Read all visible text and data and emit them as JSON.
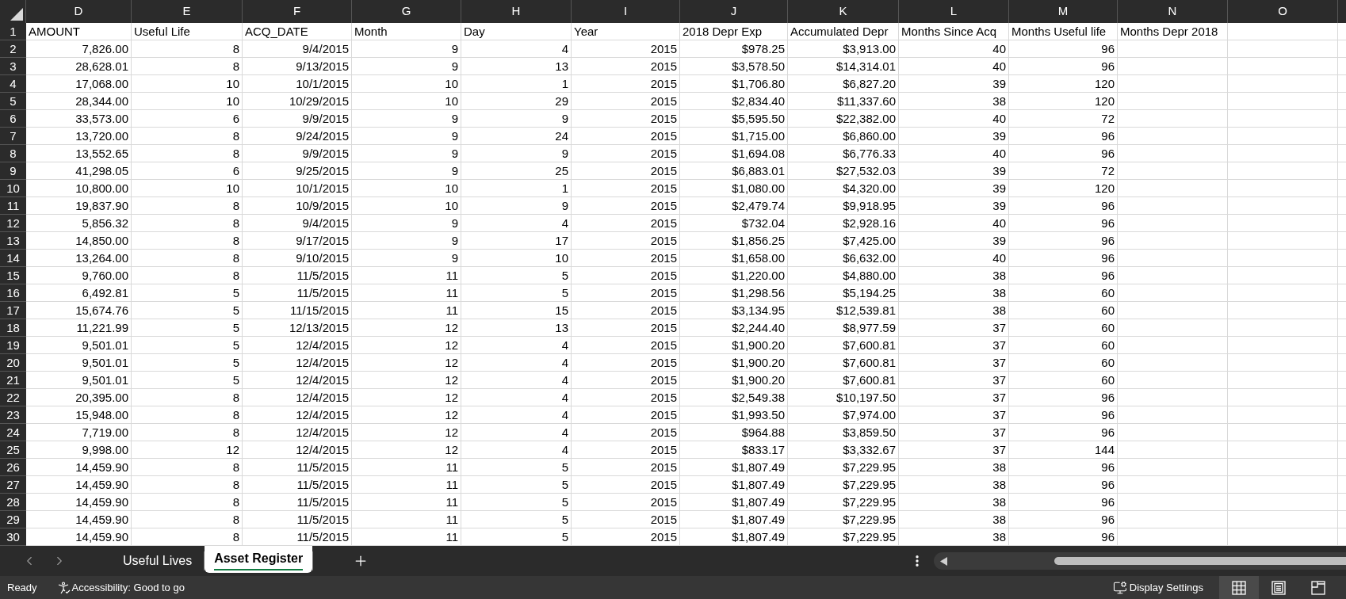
{
  "columns": [
    "D",
    "E",
    "F",
    "G",
    "H",
    "I",
    "J",
    "K",
    "L",
    "M",
    "N",
    "O"
  ],
  "rows": [
    {
      "number": "1",
      "kind": "text",
      "cells": [
        "AMOUNT",
        "Useful Life",
        "ACQ_DATE",
        "Month",
        "Day",
        "Year",
        "2018 Depr Exp",
        "Accumulated Depr",
        "Months Since Acq",
        "Months Useful life",
        "Months Depr 2018"
      ]
    },
    {
      "number": "2",
      "kind": "number",
      "cells": [
        "7,826.00",
        "8",
        "9/4/2015",
        "9",
        "4",
        "2015",
        "$978.25",
        "$3,913.00",
        "40",
        "96"
      ]
    },
    {
      "number": "3",
      "kind": "number",
      "cells": [
        "28,628.01",
        "8",
        "9/13/2015",
        "9",
        "13",
        "2015",
        "$3,578.50",
        "$14,314.01",
        "40",
        "96"
      ]
    },
    {
      "number": "4",
      "kind": "number",
      "cells": [
        "17,068.00",
        "10",
        "10/1/2015",
        "10",
        "1",
        "2015",
        "$1,706.80",
        "$6,827.20",
        "39",
        "120"
      ]
    },
    {
      "number": "5",
      "kind": "number",
      "cells": [
        "28,344.00",
        "10",
        "10/29/2015",
        "10",
        "29",
        "2015",
        "$2,834.40",
        "$11,337.60",
        "38",
        "120"
      ]
    },
    {
      "number": "6",
      "kind": "number",
      "cells": [
        "33,573.00",
        "6",
        "9/9/2015",
        "9",
        "9",
        "2015",
        "$5,595.50",
        "$22,382.00",
        "40",
        "72"
      ]
    },
    {
      "number": "7",
      "kind": "number",
      "cells": [
        "13,720.00",
        "8",
        "9/24/2015",
        "9",
        "24",
        "2015",
        "$1,715.00",
        "$6,860.00",
        "39",
        "96"
      ]
    },
    {
      "number": "8",
      "kind": "number",
      "cells": [
        "13,552.65",
        "8",
        "9/9/2015",
        "9",
        "9",
        "2015",
        "$1,694.08",
        "$6,776.33",
        "40",
        "96"
      ]
    },
    {
      "number": "9",
      "kind": "number",
      "cells": [
        "41,298.05",
        "6",
        "9/25/2015",
        "9",
        "25",
        "2015",
        "$6,883.01",
        "$27,532.03",
        "39",
        "72"
      ]
    },
    {
      "number": "10",
      "kind": "number",
      "cells": [
        "10,800.00",
        "10",
        "10/1/2015",
        "10",
        "1",
        "2015",
        "$1,080.00",
        "$4,320.00",
        "39",
        "120"
      ]
    },
    {
      "number": "11",
      "kind": "number",
      "cells": [
        "19,837.90",
        "8",
        "10/9/2015",
        "10",
        "9",
        "2015",
        "$2,479.74",
        "$9,918.95",
        "39",
        "96"
      ]
    },
    {
      "number": "12",
      "kind": "number",
      "cells": [
        "5,856.32",
        "8",
        "9/4/2015",
        "9",
        "4",
        "2015",
        "$732.04",
        "$2,928.16",
        "40",
        "96"
      ]
    },
    {
      "number": "13",
      "kind": "number",
      "cells": [
        "14,850.00",
        "8",
        "9/17/2015",
        "9",
        "17",
        "2015",
        "$1,856.25",
        "$7,425.00",
        "39",
        "96"
      ]
    },
    {
      "number": "14",
      "kind": "number",
      "cells": [
        "13,264.00",
        "8",
        "9/10/2015",
        "9",
        "10",
        "2015",
        "$1,658.00",
        "$6,632.00",
        "40",
        "96"
      ]
    },
    {
      "number": "15",
      "kind": "number",
      "cells": [
        "9,760.00",
        "8",
        "11/5/2015",
        "11",
        "5",
        "2015",
        "$1,220.00",
        "$4,880.00",
        "38",
        "96"
      ]
    },
    {
      "number": "16",
      "kind": "number",
      "cells": [
        "6,492.81",
        "5",
        "11/5/2015",
        "11",
        "5",
        "2015",
        "$1,298.56",
        "$5,194.25",
        "38",
        "60"
      ]
    },
    {
      "number": "17",
      "kind": "number",
      "cells": [
        "15,674.76",
        "5",
        "11/15/2015",
        "11",
        "15",
        "2015",
        "$3,134.95",
        "$12,539.81",
        "38",
        "60"
      ]
    },
    {
      "number": "18",
      "kind": "number",
      "cells": [
        "11,221.99",
        "5",
        "12/13/2015",
        "12",
        "13",
        "2015",
        "$2,244.40",
        "$8,977.59",
        "37",
        "60"
      ]
    },
    {
      "number": "19",
      "kind": "number",
      "cells": [
        "9,501.01",
        "5",
        "12/4/2015",
        "12",
        "4",
        "2015",
        "$1,900.20",
        "$7,600.81",
        "37",
        "60"
      ]
    },
    {
      "number": "20",
      "kind": "number",
      "cells": [
        "9,501.01",
        "5",
        "12/4/2015",
        "12",
        "4",
        "2015",
        "$1,900.20",
        "$7,600.81",
        "37",
        "60"
      ]
    },
    {
      "number": "21",
      "kind": "number",
      "cells": [
        "9,501.01",
        "5",
        "12/4/2015",
        "12",
        "4",
        "2015",
        "$1,900.20",
        "$7,600.81",
        "37",
        "60"
      ]
    },
    {
      "number": "22",
      "kind": "number",
      "cells": [
        "20,395.00",
        "8",
        "12/4/2015",
        "12",
        "4",
        "2015",
        "$2,549.38",
        "$10,197.50",
        "37",
        "96"
      ]
    },
    {
      "number": "23",
      "kind": "number",
      "cells": [
        "15,948.00",
        "8",
        "12/4/2015",
        "12",
        "4",
        "2015",
        "$1,993.50",
        "$7,974.00",
        "37",
        "96"
      ]
    },
    {
      "number": "24",
      "kind": "number",
      "cells": [
        "7,719.00",
        "8",
        "12/4/2015",
        "12",
        "4",
        "2015",
        "$964.88",
        "$3,859.50",
        "37",
        "96"
      ]
    },
    {
      "number": "25",
      "kind": "number",
      "cells": [
        "9,998.00",
        "12",
        "12/4/2015",
        "12",
        "4",
        "2015",
        "$833.17",
        "$3,332.67",
        "37",
        "144"
      ]
    },
    {
      "number": "26",
      "kind": "number",
      "cells": [
        "14,459.90",
        "8",
        "11/5/2015",
        "11",
        "5",
        "2015",
        "$1,807.49",
        "$7,229.95",
        "38",
        "96"
      ]
    },
    {
      "number": "27",
      "kind": "number",
      "cells": [
        "14,459.90",
        "8",
        "11/5/2015",
        "11",
        "5",
        "2015",
        "$1,807.49",
        "$7,229.95",
        "38",
        "96"
      ]
    },
    {
      "number": "28",
      "kind": "number",
      "cells": [
        "14,459.90",
        "8",
        "11/5/2015",
        "11",
        "5",
        "2015",
        "$1,807.49",
        "$7,229.95",
        "38",
        "96"
      ]
    },
    {
      "number": "29",
      "kind": "number",
      "cells": [
        "14,459.90",
        "8",
        "11/5/2015",
        "11",
        "5",
        "2015",
        "$1,807.49",
        "$7,229.95",
        "38",
        "96"
      ]
    },
    {
      "number": "30",
      "kind": "number",
      "cells": [
        "14,459.90",
        "8",
        "11/5/2015",
        "11",
        "5",
        "2015",
        "$1,807.49",
        "$7,229.95",
        "38",
        "96"
      ]
    }
  ],
  "sheet_tabs": [
    {
      "label": "Useful Lives",
      "selected": false
    },
    {
      "label": "Asset Register",
      "selected": true
    }
  ],
  "status_bar": {
    "status": "Ready",
    "accessibility": "Accessibility: Good to go",
    "display_settings": "Display Settings",
    "views": [
      {
        "kind": "normal",
        "selected": true
      },
      {
        "kind": "page_layout",
        "selected": false
      },
      {
        "kind": "page_break",
        "selected": false
      }
    ]
  }
}
